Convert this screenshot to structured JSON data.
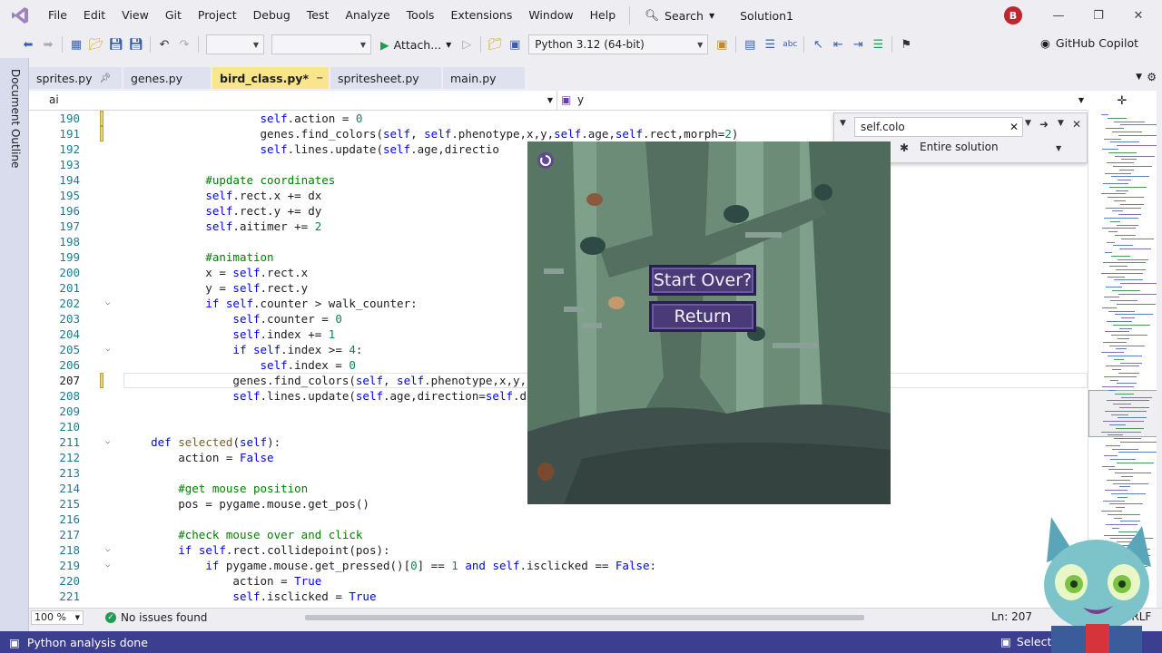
{
  "menu": [
    "File",
    "Edit",
    "View",
    "Git",
    "Project",
    "Debug",
    "Test",
    "Analyze",
    "Tools",
    "Extensions",
    "Window",
    "Help"
  ],
  "search_label": "Search",
  "solution_name": "Solution1",
  "account_initial": "B",
  "toolbar": {
    "attach_label": "Attach...",
    "python_env": "Python 3.12 (64-bit)",
    "copilot_label": "GitHub Copilot"
  },
  "sidebar_label": "Document Outline",
  "tabs": [
    {
      "label": "sprites.py",
      "pinned": true
    },
    {
      "label": "genes.py"
    },
    {
      "label": "bird_class.py*",
      "active": true
    },
    {
      "label": "spritesheet.py"
    },
    {
      "label": "main.py"
    }
  ],
  "navbar": {
    "scope": "ai",
    "member": "y"
  },
  "find": {
    "query": "self.colo",
    "scope": "Entire solution"
  },
  "code_lines": [
    {
      "n": "190",
      "html": "                    <span class='self'>self</span>.action = <span class='num'>0</span>",
      "mark": true
    },
    {
      "n": "191",
      "html": "                    genes.find_colors(<span class='self'>self</span>, <span class='self'>self</span>.phenotype,x,y,<span class='self'>self</span>.age,<span class='self'>self</span>.rect,morph=<span class='num'>2</span>)",
      "mark": true
    },
    {
      "n": "192",
      "html": "                    <span class='self'>self</span>.lines.update(<span class='self'>self</span>.age,directio"
    },
    {
      "n": "193",
      "html": ""
    },
    {
      "n": "194",
      "html": "            <span class='cm'>#update coordinates</span>"
    },
    {
      "n": "195",
      "html": "            <span class='self'>self</span>.rect.x += dx"
    },
    {
      "n": "196",
      "html": "            <span class='self'>self</span>.rect.y += dy"
    },
    {
      "n": "197",
      "html": "            <span class='self'>self</span>.aitimer += <span class='num'>2</span>"
    },
    {
      "n": "198",
      "html": ""
    },
    {
      "n": "199",
      "html": "            <span class='cm'>#animation</span>"
    },
    {
      "n": "200",
      "html": "            x = <span class='self'>self</span>.rect.x"
    },
    {
      "n": "201",
      "html": "            y = <span class='self'>self</span>.rect.y"
    },
    {
      "n": "202",
      "html": "            <span class='kw'>if</span> <span class='self'>self</span>.counter &gt; walk_counter:",
      "fold": true
    },
    {
      "n": "203",
      "html": "                <span class='self'>self</span>.counter = <span class='num'>0</span>"
    },
    {
      "n": "204",
      "html": "                <span class='self'>self</span>.index += <span class='num'>1</span>"
    },
    {
      "n": "205",
      "html": "                <span class='kw'>if</span> <span class='self'>self</span>.index &gt;= <span class='num'>4</span>:",
      "fold": true
    },
    {
      "n": "206",
      "html": "                    <span class='self'>self</span>.index = <span class='num'>0</span>"
    },
    {
      "n": "207",
      "html": "                genes.find_colors(<span class='self'>self</span>, <span class='self'>self</span>.phenotype,x,y,",
      "mark": true,
      "current": true
    },
    {
      "n": "208",
      "html": "                <span class='self'>self</span>.lines.update(<span class='self'>self</span>.age,direction=<span class='self'>self</span>.d"
    },
    {
      "n": "209",
      "html": ""
    },
    {
      "n": "210",
      "html": ""
    },
    {
      "n": "211",
      "html": "    <span class='kw'>def</span> <span class='fn'>selected</span>(<span class='self'>self</span>):",
      "fold": true
    },
    {
      "n": "212",
      "html": "        action = <span class='kw'>False</span>"
    },
    {
      "n": "213",
      "html": ""
    },
    {
      "n": "214",
      "html": "        <span class='cm'>#get mouse position</span>"
    },
    {
      "n": "215",
      "html": "        pos = pygame.mouse.get_pos()"
    },
    {
      "n": "216",
      "html": ""
    },
    {
      "n": "217",
      "html": "        <span class='cm'>#check mouse over and click</span>"
    },
    {
      "n": "218",
      "html": "        <span class='kw'>if</span> <span class='self'>self</span>.rect.collidepoint(pos):",
      "fold": true
    },
    {
      "n": "219",
      "html": "            <span class='kw'>if</span> pygame.mouse.get_pressed()[<span class='num'>0</span>] == <span class='num'>1</span> <span class='kw'>and</span> <span class='self'>self</span>.isclicked == <span class='kw'>False</span>:",
      "fold": true
    },
    {
      "n": "220",
      "html": "                action = <span class='kw'>True</span>"
    },
    {
      "n": "221",
      "html": "                <span class='self'>self</span>.isclicked = <span class='kw'>True</span>"
    }
  ],
  "game": {
    "start_over": "Start Over?",
    "return": "Return"
  },
  "editor_status": {
    "zoom": "100 %",
    "issues": "No issues found",
    "position": "Ln: 207",
    "eol": "CRLF"
  },
  "status": {
    "message": "Python analysis done",
    "repo": "Select Re"
  }
}
